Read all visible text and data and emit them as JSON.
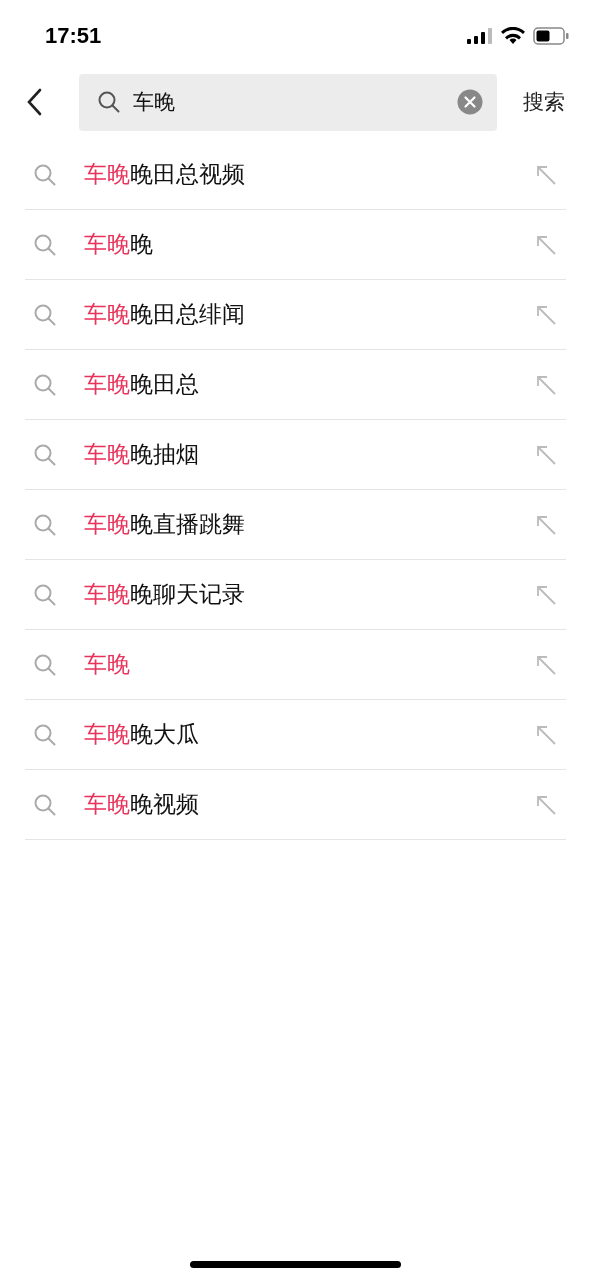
{
  "status_bar": {
    "time": "17:51"
  },
  "search": {
    "value": "车晚",
    "submit": "搜索"
  },
  "suggestions": [
    {
      "highlight": "车晚",
      "rest": "晚田总视频"
    },
    {
      "highlight": "车晚",
      "rest": "晚"
    },
    {
      "highlight": "车晚",
      "rest": "晚田总绯闻"
    },
    {
      "highlight": "车晚",
      "rest": "晚田总"
    },
    {
      "highlight": "车晚",
      "rest": "晚抽烟"
    },
    {
      "highlight": "车晚",
      "rest": "晚直播跳舞"
    },
    {
      "highlight": "车晚",
      "rest": "晚聊天记录"
    },
    {
      "highlight": "车晚"
    },
    {
      "highlight": "车晚",
      "rest": "晚大瓜"
    },
    {
      "highlight": "车晚",
      "rest": "晚视频"
    }
  ]
}
